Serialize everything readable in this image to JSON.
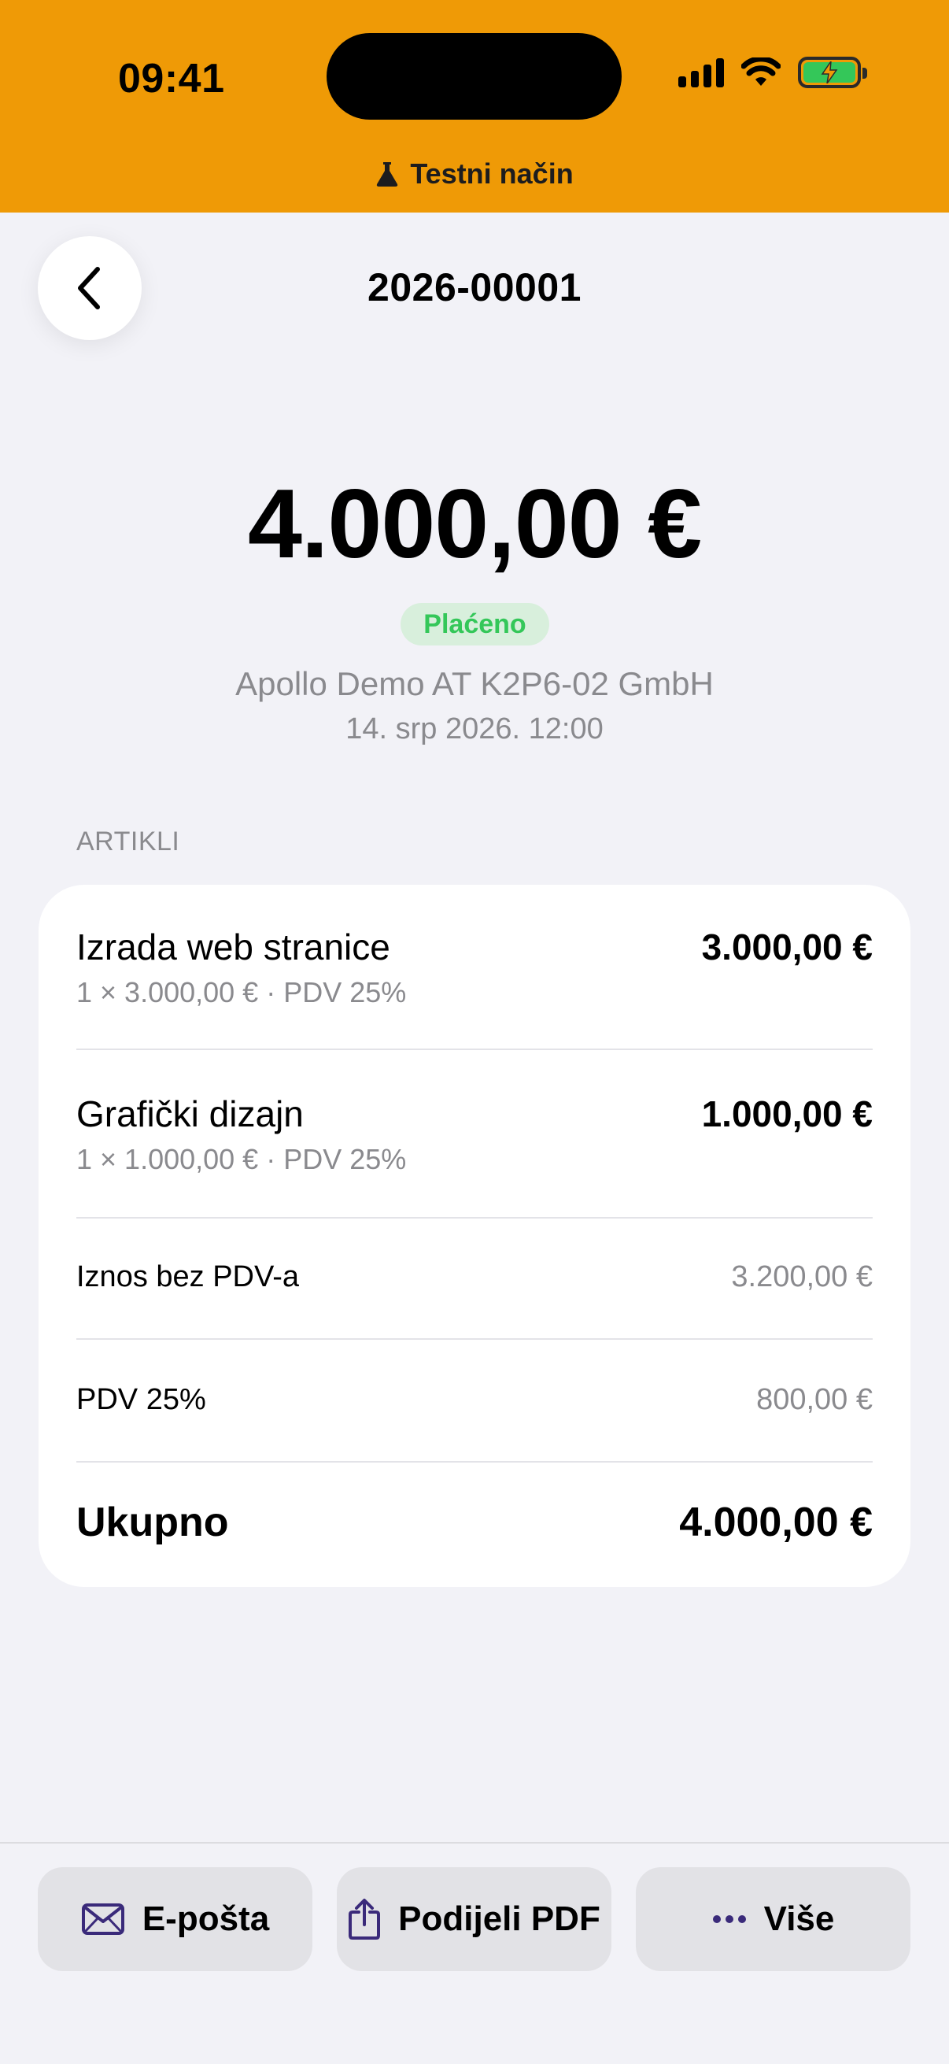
{
  "status_bar": {
    "time": "09:41"
  },
  "banner": {
    "label": "Testni način",
    "icon": "flask-icon"
  },
  "header": {
    "title": "2026-00001"
  },
  "invoice": {
    "amount": "4.000,00 €",
    "status": "Plaćeno",
    "customer": "Apollo Demo AT K2P6-02 GmbH",
    "datetime": "14. srp 2026. 12:00"
  },
  "section": {
    "items_label": "ARTIKLI"
  },
  "items": [
    {
      "name": "Izrada web stranice",
      "detail": "1 × 3.000,00 € · PDV 25%",
      "amount": "3.000,00 €"
    },
    {
      "name": "Grafički dizajn",
      "detail": "1 × 1.000,00 € · PDV 25%",
      "amount": "1.000,00 €"
    }
  ],
  "summary": {
    "net_label": "Iznos bez PDV-a",
    "net_value": "3.200,00 €",
    "vat_label": "PDV 25%",
    "vat_value": "800,00 €",
    "total_label": "Ukupno",
    "total_value": "4.000,00 €"
  },
  "actions": {
    "email_label": "E-pošta",
    "share_label": "Podijeli PDF",
    "more_label": "Više"
  },
  "colors": {
    "banner": "#ef9a06",
    "accent": "#3a2a7a",
    "paid_text": "#34c759",
    "paid_bg": "#d8efdc"
  }
}
